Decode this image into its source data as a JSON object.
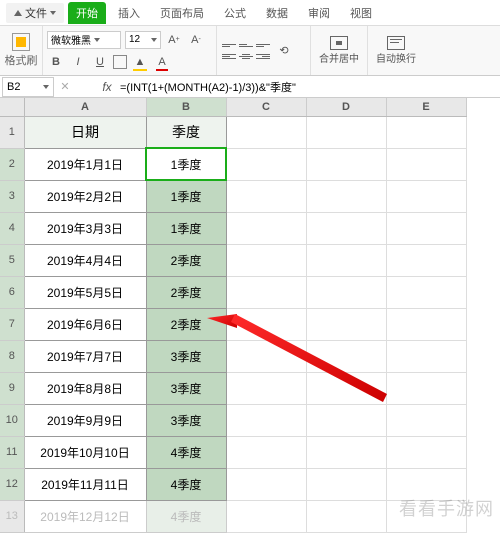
{
  "menu": {
    "file": "文件",
    "tabs": [
      "开始",
      "插入",
      "页面布局",
      "公式",
      "数据",
      "审阅",
      "视图"
    ]
  },
  "ribbon": {
    "format_painter": "格式刷",
    "font_name": "微软雅黑",
    "font_size": "12",
    "merge_label": "合并居中",
    "wrap_label": "自动换行"
  },
  "formula_bar": {
    "cell_ref": "B2",
    "fx": "fx",
    "formula": "=(INT(1+(MONTH(A2)-1)/3))&\"季度\""
  },
  "columns": [
    "A",
    "B",
    "C",
    "D",
    "E"
  ],
  "headers": {
    "A": "日期",
    "B": "季度"
  },
  "rows": [
    {
      "n": "1"
    },
    {
      "n": "2",
      "A": "2019年1月1日",
      "B": "1季度"
    },
    {
      "n": "3",
      "A": "2019年2月2日",
      "B": "1季度"
    },
    {
      "n": "4",
      "A": "2019年3月3日",
      "B": "1季度"
    },
    {
      "n": "5",
      "A": "2019年4月4日",
      "B": "2季度"
    },
    {
      "n": "6",
      "A": "2019年5月5日",
      "B": "2季度"
    },
    {
      "n": "7",
      "A": "2019年6月6日",
      "B": "2季度"
    },
    {
      "n": "8",
      "A": "2019年7月7日",
      "B": "3季度"
    },
    {
      "n": "9",
      "A": "2019年8月8日",
      "B": "3季度"
    },
    {
      "n": "10",
      "A": "2019年9月9日",
      "B": "3季度"
    },
    {
      "n": "11",
      "A": "2019年10月10日",
      "B": "4季度"
    },
    {
      "n": "12",
      "A": "2019年11月11日",
      "B": "4季度"
    },
    {
      "n": "13",
      "A": "2019年12月12日",
      "B": "4季度"
    }
  ],
  "watermark": "看看手游网"
}
